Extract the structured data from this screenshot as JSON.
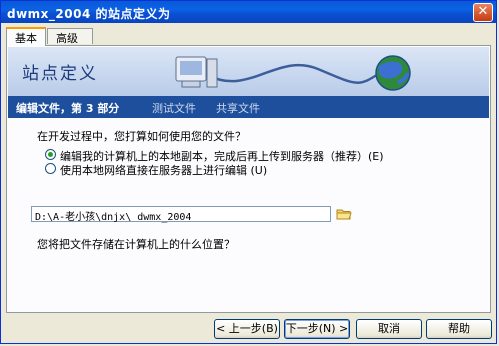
{
  "window": {
    "title": "dwmx_2004 的站点定义为",
    "close_glyph": "✕"
  },
  "tabs": [
    {
      "label": "基本"
    },
    {
      "label": "高级"
    }
  ],
  "banner": {
    "title": "站点定义"
  },
  "steps": {
    "current": "编辑文件，第 3 部分",
    "next1": "测试文件",
    "next2": "共享文件"
  },
  "question1": "在开发过程中，您打算如何使用您的文件？",
  "options": [
    {
      "label": "编辑我的计算机上的本地副本，完成后再上传到服务器（推荐）(E)",
      "checked": true
    },
    {
      "label": "使用本地网络直接在服务器上进行编辑 (U)",
      "checked": false
    }
  ],
  "question2": "您将把文件存储在计算机上的什么位置？",
  "path": {
    "value": "D:\\A-老小孩\\dnjx\\ dwmx_2004"
  },
  "icons": {
    "folder": "folder-icon",
    "globe": "globe-icon",
    "server": "server-icon"
  },
  "buttons": {
    "back": "< 上一步(B)",
    "next": "下一步(N) >",
    "cancel": "取消",
    "help": "帮助"
  }
}
